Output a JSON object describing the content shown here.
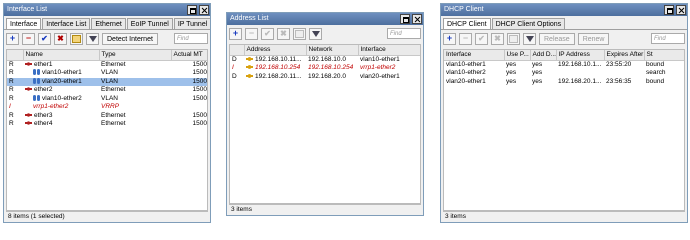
{
  "interface_list": {
    "title": "Interface List",
    "tabs": [
      "Interface",
      "Interface List",
      "Ethernet",
      "EoIP Tunnel",
      "IP Tunnel"
    ],
    "detect_internet_label": "Detect Internet",
    "find_placeholder": "Find",
    "columns": [
      "",
      "Name",
      "Type",
      "Actual MT"
    ],
    "rows": [
      {
        "flag": "R",
        "icon": "ethernet-icon",
        "name": "ether1",
        "type": "Ethernet",
        "mtu": "1500",
        "indent": false,
        "selected": false,
        "red": false
      },
      {
        "flag": "R",
        "icon": "vlan-icon",
        "name": "vlan10-ether1",
        "type": "VLAN",
        "mtu": "1500",
        "indent": true,
        "selected": false,
        "red": false
      },
      {
        "flag": "R",
        "icon": "vlan-icon",
        "name": "vlan20-ether1",
        "type": "VLAN",
        "mtu": "1500",
        "indent": true,
        "selected": true,
        "red": false
      },
      {
        "flag": "R",
        "icon": "ethernet-icon",
        "name": "ether2",
        "type": "Ethernet",
        "mtu": "1500",
        "indent": false,
        "selected": false,
        "red": false
      },
      {
        "flag": "R",
        "icon": "vlan-icon",
        "name": "vlan10-ether2",
        "type": "VLAN",
        "mtu": "1500",
        "indent": true,
        "selected": false,
        "red": false
      },
      {
        "flag": "I",
        "icon": "",
        "name": "vrrp1-ether2",
        "type": "VRRP",
        "mtu": "",
        "indent": true,
        "selected": false,
        "red": true
      },
      {
        "flag": "R",
        "icon": "ethernet-icon",
        "name": "ether3",
        "type": "Ethernet",
        "mtu": "1500",
        "indent": false,
        "selected": false,
        "red": false
      },
      {
        "flag": "R",
        "icon": "ethernet-icon",
        "name": "ether4",
        "type": "Ethernet",
        "mtu": "1500",
        "indent": false,
        "selected": false,
        "red": false
      }
    ],
    "status": "8 items (1 selected)"
  },
  "address_list": {
    "title": "Address List",
    "find_placeholder": "Find",
    "columns": [
      "",
      "Address",
      "Network",
      "Interface"
    ],
    "rows": [
      {
        "flag": "D",
        "address": "192.168.10.11...",
        "network": "192.168.10.0",
        "interface": "vlan10-ether1",
        "red": false
      },
      {
        "flag": "I",
        "address": "192.168.10.254",
        "network": "192.168.10.254",
        "interface": "vrrp1-ether2",
        "red": true
      },
      {
        "flag": "D",
        "address": "192.168.20.11...",
        "network": "192.168.20.0",
        "interface": "vlan20-ether1",
        "red": false
      }
    ],
    "status": "3 items"
  },
  "dhcp_client": {
    "title": "DHCP Client",
    "tabs": [
      "DHCP Client",
      "DHCP Client Options"
    ],
    "release_label": "Release",
    "renew_label": "Renew",
    "find_placeholder": "Find",
    "columns": [
      "Interface",
      "Use P...",
      "Add D...",
      "IP Address",
      "Expires After",
      "St"
    ],
    "rows": [
      {
        "interface": "vlan10-ether1",
        "use_peer": "yes",
        "add_default": "yes",
        "ip": "192.168.10.1...",
        "expires": "23:55:20",
        "status": "bound"
      },
      {
        "interface": "vlan10-ether2",
        "use_peer": "yes",
        "add_default": "yes",
        "ip": "",
        "expires": "",
        "status": "search"
      },
      {
        "interface": "vlan20-ether1",
        "use_peer": "yes",
        "add_default": "yes",
        "ip": "192.168.20.1...",
        "expires": "23:56:35",
        "status": "bound"
      }
    ],
    "status": "3 items"
  }
}
